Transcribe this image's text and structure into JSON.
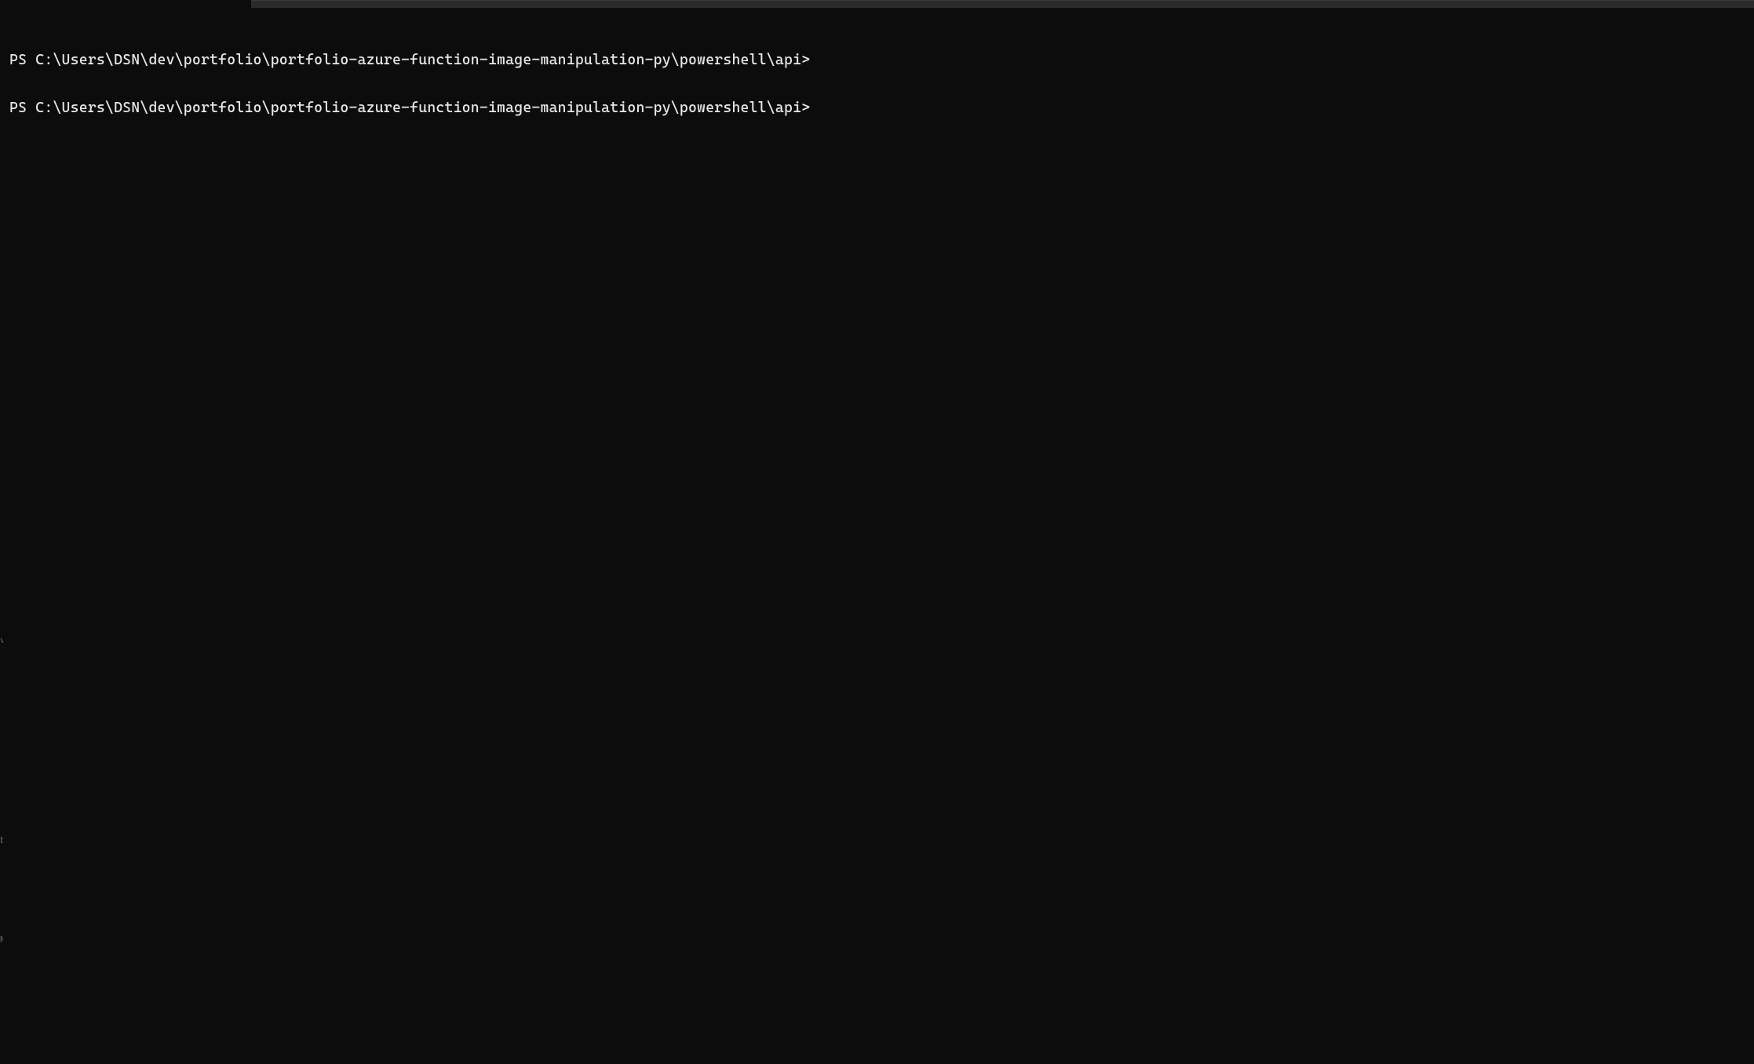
{
  "title_bar": {
    "active_tab_hint": "powershell-tab"
  },
  "terminal": {
    "lines": [
      {
        "prompt_prefix": "PS ",
        "path": "C:\\Users\\DSN\\dev\\portfolio\\portfolio-azure-function-image-manipulation-py\\powershell\\api",
        "prompt_suffix": ">"
      },
      {
        "prompt_prefix": "PS ",
        "path": "C:\\Users\\DSN\\dev\\portfolio\\portfolio-azure-function-image-manipulation-py\\powershell\\api",
        "prompt_suffix": ">"
      }
    ]
  },
  "edge_artifacts": [
    "v",
    "b",
    "N"
  ]
}
